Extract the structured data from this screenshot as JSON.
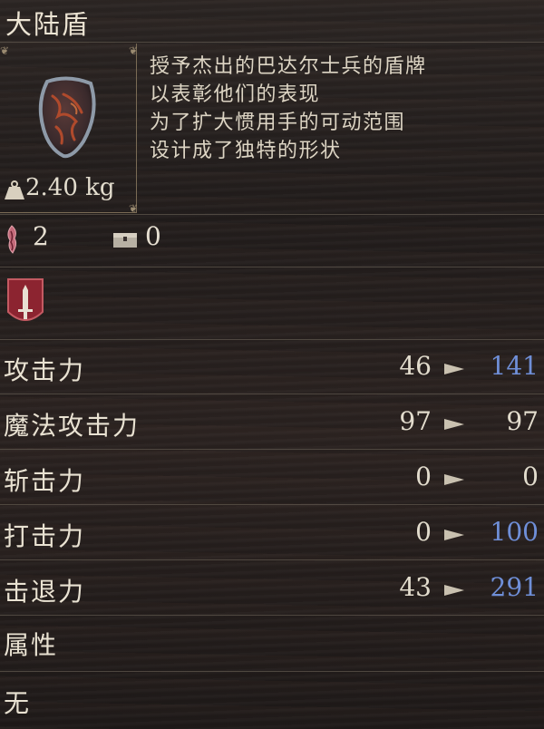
{
  "item": {
    "name": "大陆盾",
    "weight": "2.40 kg",
    "description": [
      "授予杰出的巴达尔士兵的盾牌",
      "以表彰他们的表现",
      "为了扩大惯用手的可动范围",
      "设计成了独特的形状"
    ]
  },
  "requirements": [
    {
      "icon": "rune-icon",
      "value": "2"
    },
    {
      "icon": "chest-icon",
      "value": "0"
    }
  ],
  "category_icon": "sword-crest-icon",
  "stats": [
    {
      "label": "攻击力",
      "old": "46",
      "new": "141",
      "new_color": "#6f8fd8"
    },
    {
      "label": "魔法攻击力",
      "old": "97",
      "new": "97",
      "new_color": "#e2dccd"
    },
    {
      "label": "斩击力",
      "old": "0",
      "new": "0",
      "new_color": "#e2dccd"
    },
    {
      "label": "打击力",
      "old": "0",
      "new": "100",
      "new_color": "#6f8fd8"
    },
    {
      "label": "击退力",
      "old": "43",
      "new": "291",
      "new_color": "#6f8fd8"
    }
  ],
  "attribute": {
    "label": "属性",
    "value": "无"
  },
  "colors": {
    "text": "#e6dfd1",
    "increase": "#6f8fd8",
    "divider": "#5d554c"
  }
}
